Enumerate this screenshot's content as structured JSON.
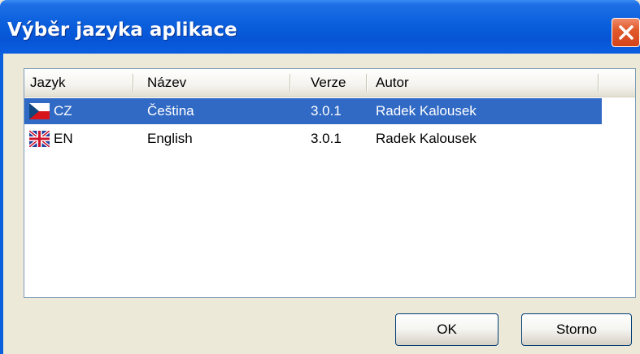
{
  "window": {
    "title": "Výběr jazyka aplikace"
  },
  "list": {
    "columns": [
      "Jazyk",
      "Název",
      "Verze",
      "Autor"
    ],
    "rows": [
      {
        "code": "CZ",
        "name": "Čeština",
        "version": "3.0.1",
        "author": "Radek Kalousek",
        "flag": "czech-flag-icon",
        "selected": true
      },
      {
        "code": "EN",
        "name": "English",
        "version": "3.0.1",
        "author": "Radek Kalousek",
        "flag": "uk-flag-icon",
        "selected": false
      }
    ]
  },
  "buttons": {
    "ok": "OK",
    "cancel": "Storno"
  },
  "colors": {
    "title_bar": "#0a5fdc",
    "selection": "#316ac5",
    "close": "#e25a2c"
  }
}
